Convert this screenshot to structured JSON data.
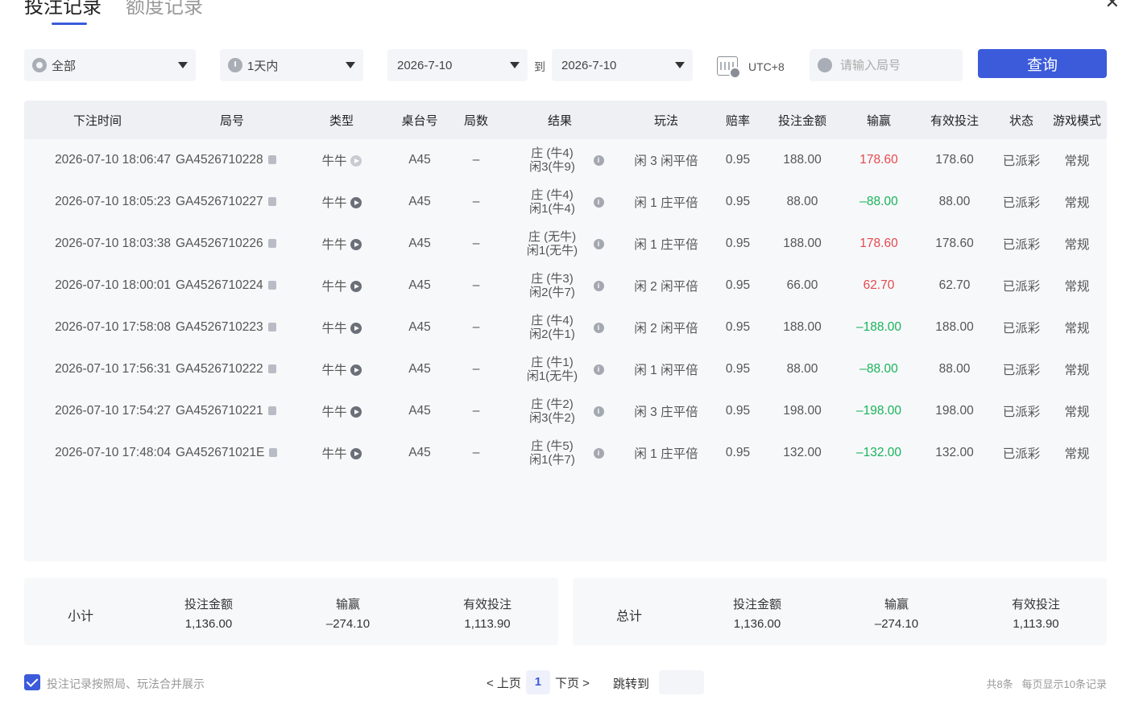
{
  "tabs": [
    {
      "label": "投注记录",
      "active": true
    },
    {
      "label": "额度记录",
      "active": false
    }
  ],
  "filters": {
    "type_label": "全部",
    "range_label": "1天内",
    "start_date": "2026-7-10",
    "end_date": "2026-7-10",
    "to_label": "到",
    "timezone": "UTC+8",
    "search_placeholder": "请输入局号",
    "query_label": "查询"
  },
  "table": {
    "columns": [
      "下注时间",
      "局号",
      "类型",
      "桌台号",
      "局数",
      "结果",
      "玩法",
      "赔率",
      "投注金额",
      "输赢",
      "有效投注",
      "状态",
      "游戏模式"
    ],
    "rows": [
      {
        "time": "2026-07-10 18:06:47",
        "round": "GA4526710228",
        "type": "牛牛",
        "table": "A45",
        "count": "–",
        "result_1": "庄 (牛4)",
        "result_2": "闲3(牛9)",
        "play": "闲 3 闲平倍",
        "odds": "0.95",
        "bet": "188.00",
        "win": "178.60",
        "win_color": "red",
        "valid": "178.60",
        "status": "已派彩",
        "mode": "常规",
        "play_icon_light": true
      },
      {
        "time": "2026-07-10 18:05:23",
        "round": "GA4526710227",
        "type": "牛牛",
        "table": "A45",
        "count": "–",
        "result_1": "庄 (牛4)",
        "result_2": "闲1(牛4)",
        "play": "闲 1 庄平倍",
        "odds": "0.95",
        "bet": "88.00",
        "win": "–88.00",
        "win_color": "green",
        "valid": "88.00",
        "status": "已派彩",
        "mode": "常规"
      },
      {
        "time": "2026-07-10 18:03:38",
        "round": "GA4526710226",
        "type": "牛牛",
        "table": "A45",
        "count": "–",
        "result_1": "庄 (无牛)",
        "result_2": "闲1(无牛)",
        "play": "闲 1 庄平倍",
        "odds": "0.95",
        "bet": "188.00",
        "win": "178.60",
        "win_color": "red",
        "valid": "178.60",
        "status": "已派彩",
        "mode": "常规"
      },
      {
        "time": "2026-07-10 18:00:01",
        "round": "GA4526710224",
        "type": "牛牛",
        "table": "A45",
        "count": "–",
        "result_1": "庄 (牛3)",
        "result_2": "闲2(牛7)",
        "play": "闲 2 闲平倍",
        "odds": "0.95",
        "bet": "66.00",
        "win": "62.70",
        "win_color": "red",
        "valid": "62.70",
        "status": "已派彩",
        "mode": "常规"
      },
      {
        "time": "2026-07-10 17:58:08",
        "round": "GA4526710223",
        "type": "牛牛",
        "table": "A45",
        "count": "–",
        "result_1": "庄 (牛4)",
        "result_2": "闲2(牛1)",
        "play": "闲 2 闲平倍",
        "odds": "0.95",
        "bet": "188.00",
        "win": "–188.00",
        "win_color": "green",
        "valid": "188.00",
        "status": "已派彩",
        "mode": "常规"
      },
      {
        "time": "2026-07-10 17:56:31",
        "round": "GA4526710222",
        "type": "牛牛",
        "table": "A45",
        "count": "–",
        "result_1": "庄 (牛1)",
        "result_2": "闲1(无牛)",
        "play": "闲 1 闲平倍",
        "odds": "0.95",
        "bet": "88.00",
        "win": "–88.00",
        "win_color": "green",
        "valid": "88.00",
        "status": "已派彩",
        "mode": "常规"
      },
      {
        "time": "2026-07-10 17:54:27",
        "round": "GA4526710221",
        "type": "牛牛",
        "table": "A45",
        "count": "–",
        "result_1": "庄 (牛2)",
        "result_2": "闲3(牛2)",
        "play": "闲 3 庄平倍",
        "odds": "0.95",
        "bet": "198.00",
        "win": "–198.00",
        "win_color": "green",
        "valid": "198.00",
        "status": "已派彩",
        "mode": "常规"
      },
      {
        "time": "2026-07-10 17:48:04",
        "round": "GA452671021E",
        "type": "牛牛",
        "table": "A45",
        "count": "–",
        "result_1": "庄 (牛5)",
        "result_2": "闲1(牛7)",
        "play": "闲 1 庄平倍",
        "odds": "0.95",
        "bet": "132.00",
        "win": "–132.00",
        "win_color": "green",
        "valid": "132.00",
        "status": "已派彩",
        "mode": "常规"
      }
    ]
  },
  "subtotal": {
    "label": "小计",
    "bet_label": "投注金额",
    "bet": "1,136.00",
    "win_label": "输赢",
    "win": "–274.10",
    "valid_label": "有效投注",
    "valid": "1,113.90"
  },
  "total": {
    "label": "总计",
    "bet_label": "投注金额",
    "bet": "1,136.00",
    "win_label": "输赢",
    "win": "–274.10",
    "valid_label": "有效投注",
    "valid": "1,113.90"
  },
  "footer": {
    "merge_label": "投注记录按照局、玩法合并展示",
    "prev_label": "< 上页",
    "page": "1",
    "next_label": "下页 >",
    "jump_label": "跳转到",
    "count_info": "共8条",
    "per_page_info": "每页显示10条记录"
  },
  "colors": {
    "accent": "#3b5bdb",
    "win_red": "#e5484d",
    "loss_green": "#17b45a"
  }
}
